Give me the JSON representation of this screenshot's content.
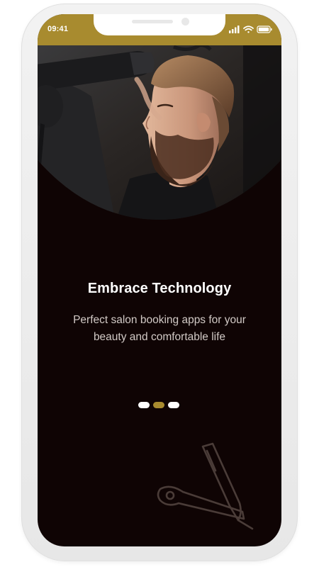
{
  "status_bar": {
    "time": "09:41",
    "icons": [
      "signal-icon",
      "wifi-icon",
      "battery-icon"
    ]
  },
  "hero": {
    "image": "barber-styling-man-with-hair-dryer-photo"
  },
  "onboarding": {
    "title": "Embrace Technology",
    "subtitle": "Perfect salon booking apps for your beauty and comfortable life",
    "pager": {
      "total": 3,
      "active_index": 1
    }
  },
  "decoration": {
    "icon": "straight-razor-icon"
  },
  "colors": {
    "accent": "#a88b2f",
    "background": "#0f0404",
    "title": "#ffffff",
    "subtitle": "#d2cac6",
    "dot_inactive": "#ffffff",
    "dot_active": "#a88b2f"
  }
}
